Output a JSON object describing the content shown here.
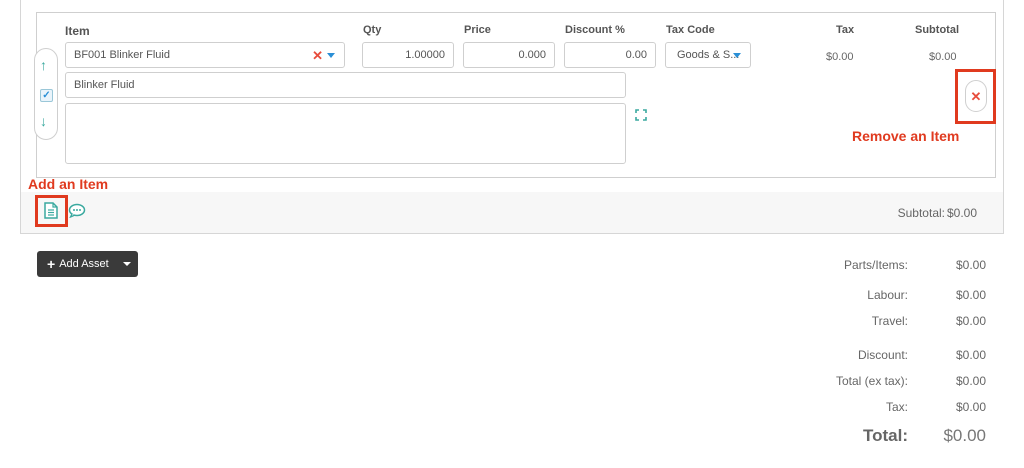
{
  "columns": {
    "item": "Item",
    "qty": "Qty",
    "price": "Price",
    "discount": "Discount %",
    "tax_code": "Tax Code",
    "tax": "Tax",
    "subtotal": "Subtotal"
  },
  "line_item": {
    "item_value": "BF001 Blinker Fluid",
    "qty": "1.00000",
    "price": "0.000",
    "discount": "0.00",
    "tax_code": "Goods & S...",
    "tax": "$0.00",
    "subtotal": "$0.00",
    "description": "Blinker Fluid",
    "notes": "",
    "selected": true
  },
  "annotations": {
    "remove_item": "Remove an Item",
    "add_item": "Add an Item"
  },
  "footer": {
    "subtotal_label": "Subtotal:",
    "subtotal_value": "$0.00"
  },
  "add_asset_button": {
    "label": "Add Asset"
  },
  "summary": [
    {
      "label": "Parts/Items:",
      "value": "$0.00"
    },
    {
      "label": "Labour:",
      "value": "$0.00"
    },
    {
      "label": "Travel:",
      "value": "$0.00"
    },
    {
      "label": "Discount:",
      "value": "$0.00"
    },
    {
      "label": "Total (ex tax):",
      "value": "$0.00"
    },
    {
      "label": "Tax:",
      "value": "$0.00"
    },
    {
      "label": "Total:",
      "value": "$0.00"
    }
  ],
  "icons": {
    "move_up": "arrow-up-icon",
    "move_down": "arrow-down-icon",
    "clear": "close-icon",
    "dropdown": "chevron-down-icon",
    "expand": "expand-icon",
    "remove": "close-icon",
    "add_item": "document-icon",
    "comment": "comment-icon"
  },
  "colors": {
    "accent_teal": "#3aa99f",
    "callout_red": "#e03a1f",
    "dropdown_blue": "#2a8fd6",
    "button_dark": "#3a3a3a"
  }
}
